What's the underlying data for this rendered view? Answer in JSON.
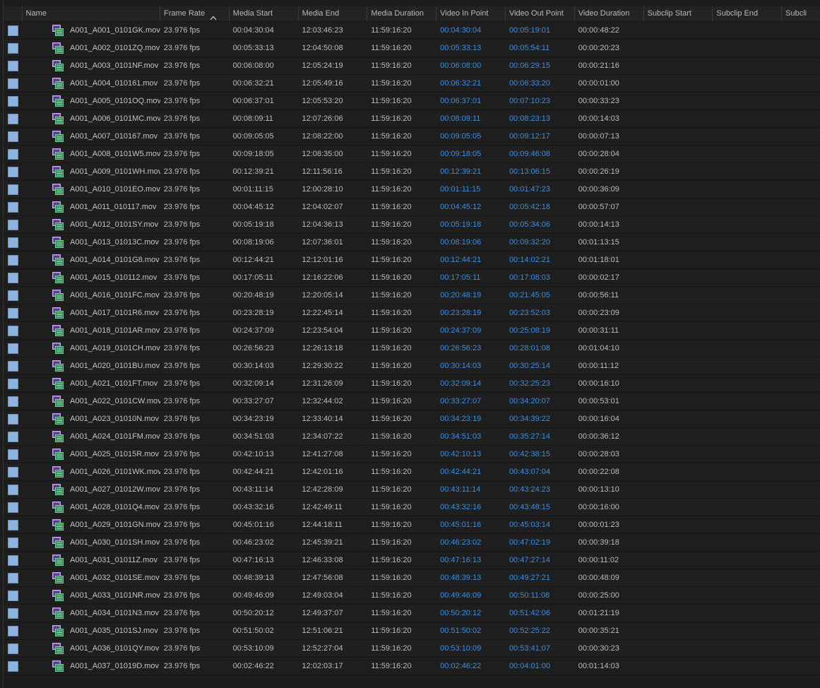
{
  "columns": [
    {
      "key": "name",
      "label": "Name"
    },
    {
      "key": "frame_rate",
      "label": "Frame Rate"
    },
    {
      "key": "media_start",
      "label": "Media Start"
    },
    {
      "key": "media_end",
      "label": "Media End"
    },
    {
      "key": "media_duration",
      "label": "Media Duration"
    },
    {
      "key": "video_in",
      "label": "Video In Point"
    },
    {
      "key": "video_out",
      "label": "Video Out Point"
    },
    {
      "key": "video_duration",
      "label": "Video Duration"
    },
    {
      "key": "subclip_start",
      "label": "Subclip Start"
    },
    {
      "key": "subclip_end",
      "label": "Subclip End"
    },
    {
      "key": "subclip_more",
      "label": "Subcli"
    }
  ],
  "sort": {
    "column": "frame_rate",
    "direction": "ascending",
    "icon": "sort-ascending-icon"
  },
  "colors": {
    "label_chip": "#8db3e0",
    "timecode_blue": "#3d8fe0",
    "background": "#1d1d1d"
  },
  "rows": [
    {
      "name": "A001_A001_0101GK.mov",
      "frame_rate": "23.976 fps",
      "media_start": "00:04:30:04",
      "media_end": "12:03:46:23",
      "media_duration": "11:59:16:20",
      "video_in": "00:04:30:04",
      "video_out": "00:05:19:01",
      "video_duration": "00:00:48:22"
    },
    {
      "name": "A001_A002_0101ZQ.mov",
      "frame_rate": "23.976 fps",
      "media_start": "00:05:33:13",
      "media_end": "12:04:50:08",
      "media_duration": "11:59:16:20",
      "video_in": "00:05:33:13",
      "video_out": "00:05:54:11",
      "video_duration": "00:00:20:23"
    },
    {
      "name": "A001_A003_0101NF.mov",
      "frame_rate": "23.976 fps",
      "media_start": "00:06:08:00",
      "media_end": "12:05:24:19",
      "media_duration": "11:59:16:20",
      "video_in": "00:06:08:00",
      "video_out": "00:06:29:15",
      "video_duration": "00:00:21:16"
    },
    {
      "name": "A001_A004_010161.mov",
      "frame_rate": "23.976 fps",
      "media_start": "00:06:32:21",
      "media_end": "12:05:49:16",
      "media_duration": "11:59:16:20",
      "video_in": "00:06:32:21",
      "video_out": "00:06:33:20",
      "video_duration": "00:00:01:00"
    },
    {
      "name": "A001_A005_0101OQ.mov",
      "frame_rate": "23.976 fps",
      "media_start": "00:06:37:01",
      "media_end": "12:05:53:20",
      "media_duration": "11:59:16:20",
      "video_in": "00:06:37:01",
      "video_out": "00:07:10:23",
      "video_duration": "00:00:33:23"
    },
    {
      "name": "A001_A006_0101MC.mov",
      "frame_rate": "23.976 fps",
      "media_start": "00:08:09:11",
      "media_end": "12:07:26:06",
      "media_duration": "11:59:16:20",
      "video_in": "00:08:09:11",
      "video_out": "00:08:23:13",
      "video_duration": "00:00:14:03"
    },
    {
      "name": "A001_A007_010167.mov",
      "frame_rate": "23.976 fps",
      "media_start": "00:09:05:05",
      "media_end": "12:08:22:00",
      "media_duration": "11:59:16:20",
      "video_in": "00:09:05:05",
      "video_out": "00:09:12:17",
      "video_duration": "00:00:07:13"
    },
    {
      "name": "A001_A008_0101W5.mov",
      "frame_rate": "23.976 fps",
      "media_start": "00:09:18:05",
      "media_end": "12:08:35:00",
      "media_duration": "11:59:16:20",
      "video_in": "00:09:18:05",
      "video_out": "00:09:46:08",
      "video_duration": "00:00:28:04"
    },
    {
      "name": "A001_A009_0101WH.mov",
      "frame_rate": "23.976 fps",
      "media_start": "00:12:39:21",
      "media_end": "12:11:56:16",
      "media_duration": "11:59:16:20",
      "video_in": "00:12:39:21",
      "video_out": "00:13:06:15",
      "video_duration": "00:00:26:19"
    },
    {
      "name": "A001_A010_0101EO.mov",
      "frame_rate": "23.976 fps",
      "media_start": "00:01:11:15",
      "media_end": "12:00:28:10",
      "media_duration": "11:59:16:20",
      "video_in": "00:01:11:15",
      "video_out": "00:01:47:23",
      "video_duration": "00:00:36:09"
    },
    {
      "name": "A001_A011_010117.mov",
      "frame_rate": "23.976 fps",
      "media_start": "00:04:45:12",
      "media_end": "12:04:02:07",
      "media_duration": "11:59:16:20",
      "video_in": "00:04:45:12",
      "video_out": "00:05:42:18",
      "video_duration": "00:00:57:07"
    },
    {
      "name": "A001_A012_0101SY.mov",
      "frame_rate": "23.976 fps",
      "media_start": "00:05:19:18",
      "media_end": "12:04:36:13",
      "media_duration": "11:59:16:20",
      "video_in": "00:05:19:18",
      "video_out": "00:05:34:06",
      "video_duration": "00:00:14:13"
    },
    {
      "name": "A001_A013_01013C.mov",
      "frame_rate": "23.976 fps",
      "media_start": "00:08:19:06",
      "media_end": "12:07:36:01",
      "media_duration": "11:59:16:20",
      "video_in": "00:08:19:06",
      "video_out": "00:09:32:20",
      "video_duration": "00:01:13:15"
    },
    {
      "name": "A001_A014_0101G8.mov",
      "frame_rate": "23.976 fps",
      "media_start": "00:12:44:21",
      "media_end": "12:12:01:16",
      "media_duration": "11:59:16:20",
      "video_in": "00:12:44:21",
      "video_out": "00:14:02:21",
      "video_duration": "00:01:18:01"
    },
    {
      "name": "A001_A015_010112.mov",
      "frame_rate": "23.976 fps",
      "media_start": "00:17:05:11",
      "media_end": "12:16:22:06",
      "media_duration": "11:59:16:20",
      "video_in": "00:17:05:11",
      "video_out": "00:17:08:03",
      "video_duration": "00:00:02:17"
    },
    {
      "name": "A001_A016_0101FC.mov",
      "frame_rate": "23.976 fps",
      "media_start": "00:20:48:19",
      "media_end": "12:20:05:14",
      "media_duration": "11:59:16:20",
      "video_in": "00:20:48:19",
      "video_out": "00:21:45:05",
      "video_duration": "00:00:56:11"
    },
    {
      "name": "A001_A017_0101R6.mov",
      "frame_rate": "23.976 fps",
      "media_start": "00:23:28:19",
      "media_end": "12:22:45:14",
      "media_duration": "11:59:16:20",
      "video_in": "00:23:28:19",
      "video_out": "00:23:52:03",
      "video_duration": "00:00:23:09"
    },
    {
      "name": "A001_A018_0101AR.mov",
      "frame_rate": "23.976 fps",
      "media_start": "00:24:37:09",
      "media_end": "12:23:54:04",
      "media_duration": "11:59:16:20",
      "video_in": "00:24:37:09",
      "video_out": "00:25:08:19",
      "video_duration": "00:00:31:11"
    },
    {
      "name": "A001_A019_0101CH.mov",
      "frame_rate": "23.976 fps",
      "media_start": "00:26:56:23",
      "media_end": "12:26:13:18",
      "media_duration": "11:59:16:20",
      "video_in": "00:26:56:23",
      "video_out": "00:28:01:08",
      "video_duration": "00:01:04:10"
    },
    {
      "name": "A001_A020_0101BU.mov",
      "frame_rate": "23.976 fps",
      "media_start": "00:30:14:03",
      "media_end": "12:29:30:22",
      "media_duration": "11:59:16:20",
      "video_in": "00:30:14:03",
      "video_out": "00:30:25:14",
      "video_duration": "00:00:11:12"
    },
    {
      "name": "A001_A021_0101FT.mov",
      "frame_rate": "23.976 fps",
      "media_start": "00:32:09:14",
      "media_end": "12:31:26:09",
      "media_duration": "11:59:16:20",
      "video_in": "00:32:09:14",
      "video_out": "00:32:25:23",
      "video_duration": "00:00:16:10"
    },
    {
      "name": "A001_A022_0101CW.mov",
      "frame_rate": "23.976 fps",
      "media_start": "00:33:27:07",
      "media_end": "12:32:44:02",
      "media_duration": "11:59:16:20",
      "video_in": "00:33:27:07",
      "video_out": "00:34:20:07",
      "video_duration": "00:00:53:01"
    },
    {
      "name": "A001_A023_01010N.mov",
      "frame_rate": "23.976 fps",
      "media_start": "00:34:23:19",
      "media_end": "12:33:40:14",
      "media_duration": "11:59:16:20",
      "video_in": "00:34:23:19",
      "video_out": "00:34:39:22",
      "video_duration": "00:00:16:04"
    },
    {
      "name": "A001_A024_0101FM.mov",
      "frame_rate": "23.976 fps",
      "media_start": "00:34:51:03",
      "media_end": "12:34:07:22",
      "media_duration": "11:59:16:20",
      "video_in": "00:34:51:03",
      "video_out": "00:35:27:14",
      "video_duration": "00:00:36:12"
    },
    {
      "name": "A001_A025_01015R.mov",
      "frame_rate": "23.976 fps",
      "media_start": "00:42:10:13",
      "media_end": "12:41:27:08",
      "media_duration": "11:59:16:20",
      "video_in": "00:42:10:13",
      "video_out": "00:42:38:15",
      "video_duration": "00:00:28:03"
    },
    {
      "name": "A001_A026_0101WK.mov",
      "frame_rate": "23.976 fps",
      "media_start": "00:42:44:21",
      "media_end": "12:42:01:16",
      "media_duration": "11:59:16:20",
      "video_in": "00:42:44:21",
      "video_out": "00:43:07:04",
      "video_duration": "00:00:22:08"
    },
    {
      "name": "A001_A027_01012W.mov",
      "frame_rate": "23.976 fps",
      "media_start": "00:43:11:14",
      "media_end": "12:42:28:09",
      "media_duration": "11:59:16:20",
      "video_in": "00:43:11:14",
      "video_out": "00:43:24:23",
      "video_duration": "00:00:13:10"
    },
    {
      "name": "A001_A028_0101Q4.mov",
      "frame_rate": "23.976 fps",
      "media_start": "00:43:32:16",
      "media_end": "12:42:49:11",
      "media_duration": "11:59:16:20",
      "video_in": "00:43:32:16",
      "video_out": "00:43:48:15",
      "video_duration": "00:00:16:00"
    },
    {
      "name": "A001_A029_0101GN.mov",
      "frame_rate": "23.976 fps",
      "media_start": "00:45:01:16",
      "media_end": "12:44:18:11",
      "media_duration": "11:59:16:20",
      "video_in": "00:45:01:16",
      "video_out": "00:45:03:14",
      "video_duration": "00:00:01:23"
    },
    {
      "name": "A001_A030_0101SH.mov",
      "frame_rate": "23.976 fps",
      "media_start": "00:46:23:02",
      "media_end": "12:45:39:21",
      "media_duration": "11:59:16:20",
      "video_in": "00:46:23:02",
      "video_out": "00:47:02:19",
      "video_duration": "00:00:39:18"
    },
    {
      "name": "A001_A031_01011Z.mov",
      "frame_rate": "23.976 fps",
      "media_start": "00:47:16:13",
      "media_end": "12:46:33:08",
      "media_duration": "11:59:16:20",
      "video_in": "00:47:16:13",
      "video_out": "00:47:27:14",
      "video_duration": "00:00:11:02"
    },
    {
      "name": "A001_A032_0101SE.mov",
      "frame_rate": "23.976 fps",
      "media_start": "00:48:39:13",
      "media_end": "12:47:56:08",
      "media_duration": "11:59:16:20",
      "video_in": "00:48:39:13",
      "video_out": "00:49:27:21",
      "video_duration": "00:00:48:09"
    },
    {
      "name": "A001_A033_0101NR.mov",
      "frame_rate": "23.976 fps",
      "media_start": "00:49:46:09",
      "media_end": "12:49:03:04",
      "media_duration": "11:59:16:20",
      "video_in": "00:49:46:09",
      "video_out": "00:50:11:08",
      "video_duration": "00:00:25:00"
    },
    {
      "name": "A001_A034_0101N3.mov",
      "frame_rate": "23.976 fps",
      "media_start": "00:50:20:12",
      "media_end": "12:49:37:07",
      "media_duration": "11:59:16:20",
      "video_in": "00:50:20:12",
      "video_out": "00:51:42:06",
      "video_duration": "00:01:21:19"
    },
    {
      "name": "A001_A035_0101SJ.mov",
      "frame_rate": "23.976 fps",
      "media_start": "00:51:50:02",
      "media_end": "12:51:06:21",
      "media_duration": "11:59:16:20",
      "video_in": "00:51:50:02",
      "video_out": "00:52:25:22",
      "video_duration": "00:00:35:21"
    },
    {
      "name": "A001_A036_0101QY.mov",
      "frame_rate": "23.976 fps",
      "media_start": "00:53:10:09",
      "media_end": "12:52:27:04",
      "media_duration": "11:59:16:20",
      "video_in": "00:53:10:09",
      "video_out": "00:53:41:07",
      "video_duration": "00:00:30:23"
    },
    {
      "name": "A001_A037_01019D.mov",
      "frame_rate": "23.976 fps",
      "media_start": "00:02:46:22",
      "media_end": "12:02:03:17",
      "media_duration": "11:59:16:20",
      "video_in": "00:02:46:22",
      "video_out": "00:04:01:00",
      "video_duration": "00:01:14:03"
    }
  ]
}
